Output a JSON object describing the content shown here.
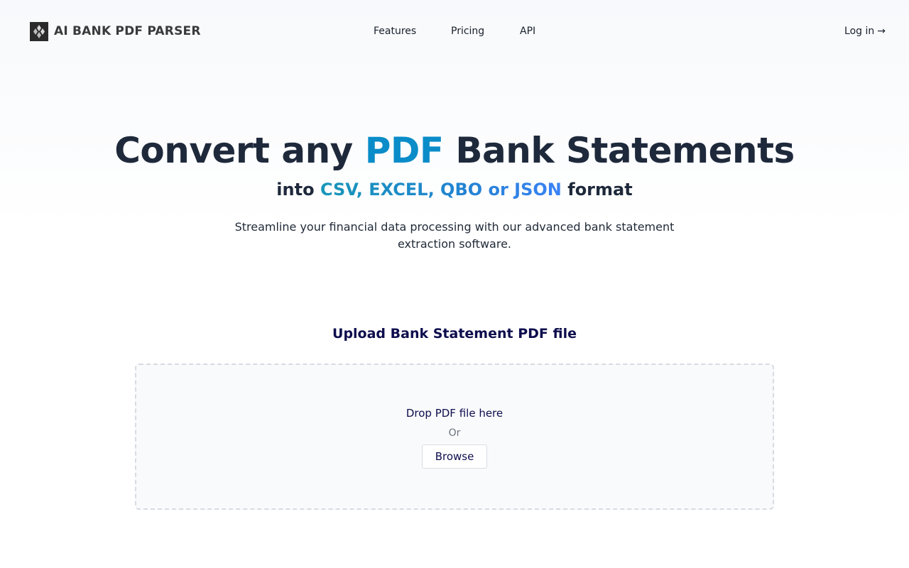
{
  "header": {
    "logo_text": "AI BANK PDF PARSER",
    "nav": {
      "features": "Features",
      "pricing": "Pricing",
      "api": "API"
    },
    "login_label": "Log in",
    "login_arrow": "→"
  },
  "hero": {
    "title_prefix": "Convert any ",
    "title_accent": "PDF",
    "title_suffix": " Bank Statements",
    "sub_prefix": "into ",
    "sub_formats": "CSV, EXCEL, QBO or JSON",
    "sub_suffix": " format",
    "description": "Streamline your financial data processing with our advanced bank statement extraction software."
  },
  "upload": {
    "title": "Upload Bank Statement PDF file",
    "drop_text": "Drop PDF file here",
    "or_text": "Or",
    "browse_label": "Browse"
  },
  "colors": {
    "accent": "#0a8cc9",
    "heading": "#1e293b",
    "upload_heading": "#0d0d4d"
  },
  "icons": {
    "logo": "diamond-logo-icon",
    "login_arrow": "arrow-right-icon"
  }
}
